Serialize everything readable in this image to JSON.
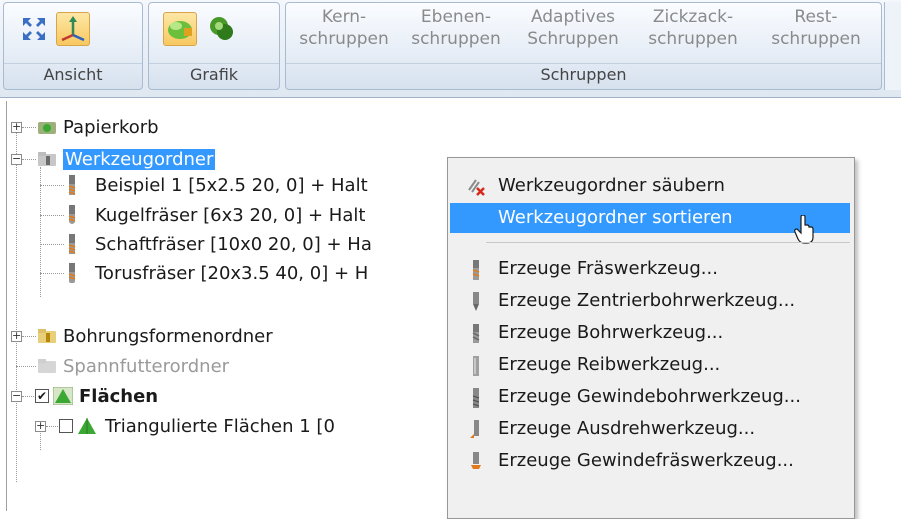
{
  "ribbon": {
    "groups": [
      {
        "label": "Ansicht"
      },
      {
        "label": "Grafik"
      },
      {
        "label": "Schruppen"
      }
    ],
    "commands": [
      {
        "line1": "Kern-",
        "line2": "schruppen"
      },
      {
        "line1": "Ebenen-",
        "line2": "schruppen"
      },
      {
        "line1": "Adaptives",
        "line2": "Schruppen"
      },
      {
        "line1": "Zickzack-",
        "line2": "schruppen"
      },
      {
        "line1": "Rest-",
        "line2": "schruppen"
      }
    ]
  },
  "tree": {
    "items": [
      {
        "label": "Papierkorb"
      },
      {
        "label": "Werkzeugordner"
      },
      {
        "label": "Beispiel 1 [5x2.5 20, 0] + Halt"
      },
      {
        "label": "Kugelfräser [6x3 20, 0] + Halt"
      },
      {
        "label": "Schaftfräser [10x0 20, 0] + Ha"
      },
      {
        "label": "Torusfräser [20x3.5 40, 0] + H"
      },
      {
        "label": "Bohrungsformenordner"
      },
      {
        "label": "Spannfutterordner"
      },
      {
        "label": "Flächen"
      },
      {
        "label": "Triangulierte Flächen 1 [0"
      }
    ]
  },
  "context_menu": {
    "items": [
      {
        "label": "Werkzeugordner säubern",
        "icon": "clean-icon"
      },
      {
        "label": "Werkzeugordner sortieren",
        "icon": "sort-icon"
      },
      {
        "label": "Erzeuge Fräswerkzeug...",
        "icon": "end-mill-icon"
      },
      {
        "label": "Erzeuge Zentrierbohrwerkzeug...",
        "icon": "spot-drill-icon"
      },
      {
        "label": "Erzeuge Bohrwerkzeug...",
        "icon": "drill-icon"
      },
      {
        "label": "Erzeuge Reibwerkzeug...",
        "icon": "reamer-icon"
      },
      {
        "label": "Erzeuge Gewindebohrwerkzeug...",
        "icon": "tap-icon"
      },
      {
        "label": "Erzeuge Ausdrehwerkzeug...",
        "icon": "boring-bar-icon"
      },
      {
        "label": "Erzeuge Gewindefräswerkzeug...",
        "icon": "thread-mill-icon"
      }
    ]
  },
  "colors": {
    "selection": "#3399ff",
    "ribbon_active": "#f8c860",
    "tree_green": "#3aa832"
  }
}
